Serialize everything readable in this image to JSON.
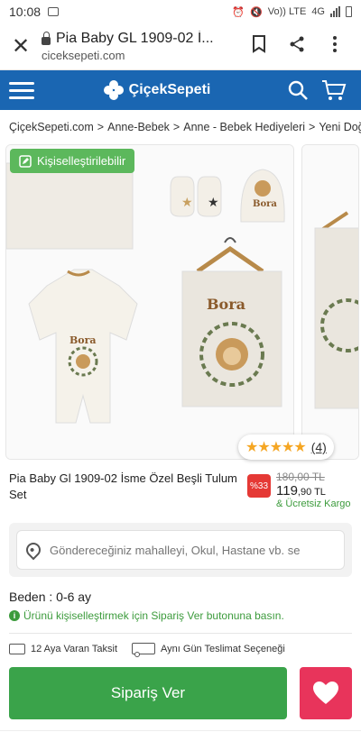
{
  "status_bar": {
    "time": "10:08",
    "network": "Vo)) LTE",
    "signal": "4G"
  },
  "browser": {
    "page_title": "Pia Baby GL 1909-02 İ...",
    "url": "ciceksepeti.com"
  },
  "header": {
    "logo_text": "ÇiçekSepeti",
    "accent_color": "#1a66b2"
  },
  "breadcrumb": {
    "items": [
      "ÇiçekSepeti.com",
      "Anne-Bebek",
      "Anne - Bebek Hediyeleri",
      "Yeni Doğ"
    ]
  },
  "gallery": {
    "badge_text": "Kişiselleştirilebilir",
    "rating_stars": "★★★★★",
    "rating_count": "(4)",
    "image_text_name": "Bora"
  },
  "product": {
    "name": "Pia Baby Gl 1909-02 İsme Özel Beşli Tulum Set",
    "discount": "%33",
    "old_price": "180,00 TL",
    "new_price_main": "119",
    "new_price_rest": ",90 TL",
    "cargo": "& Ücretsiz Kargo"
  },
  "delivery": {
    "placeholder": "Göndereceğiniz mahalleyi, Okul, Hastane vb. se"
  },
  "size": {
    "label": "Beden : 0-6 ay"
  },
  "notice": {
    "text": "Ürünü kişiselleştirmek için Sipariş Ver butonuna basın."
  },
  "perks": {
    "installment": "12 Aya Varan Taksit",
    "same_day": "Aynı Gün Teslimat Seçeneği"
  },
  "actions": {
    "order_label": "Sipariş Ver",
    "order_color": "#3aa34a",
    "favorite_color": "#e8345b"
  }
}
